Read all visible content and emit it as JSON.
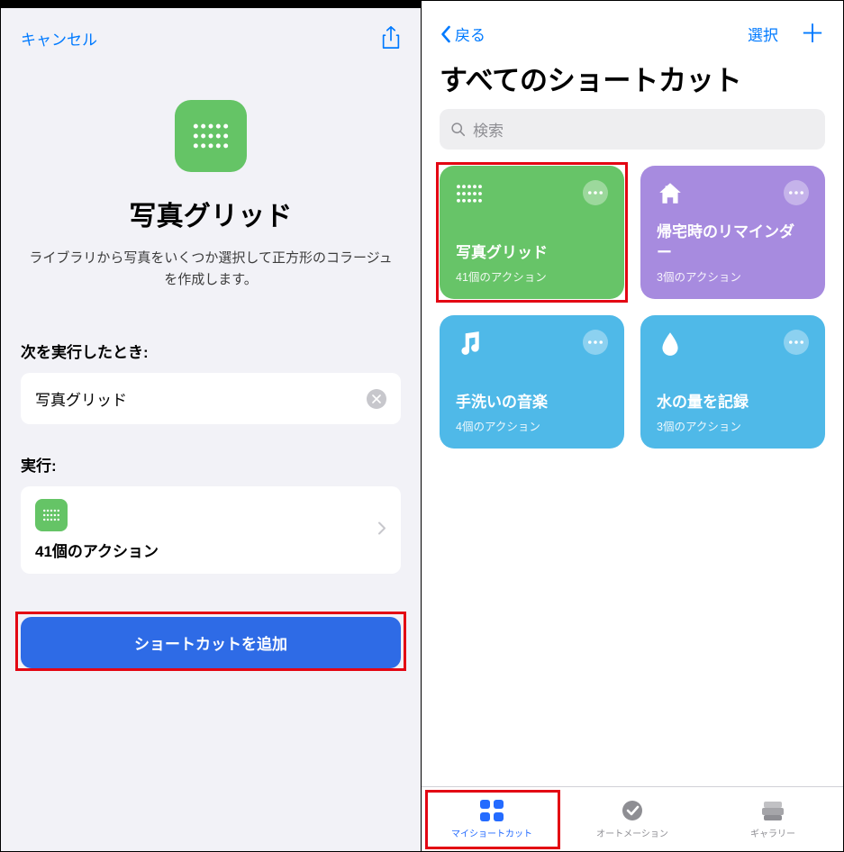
{
  "left": {
    "cancel": "キャンセル",
    "title": "写真グリッド",
    "description": "ライブラリから写真をいくつか選択して正方形のコラージュを作成します。",
    "when_label": "次を実行したとき:",
    "when_value": "写真グリッド",
    "exec_label": "実行:",
    "exec_value": "41個のアクション",
    "add_button": "ショートカットを追加"
  },
  "right": {
    "back": "戻る",
    "select": "選択",
    "title": "すべてのショートカット",
    "search_placeholder": "検索",
    "tiles": [
      {
        "name": "写真グリッド",
        "sub": "41個のアクション"
      },
      {
        "name": "帰宅時のリマインダー",
        "sub": "3個のアクション"
      },
      {
        "name": "手洗いの音楽",
        "sub": "4個のアクション"
      },
      {
        "name": "水の量を記録",
        "sub": "3個のアクション"
      }
    ],
    "tabs": {
      "my": "マイショートカット",
      "automation": "オートメーション",
      "gallery": "ギャラリー"
    }
  }
}
